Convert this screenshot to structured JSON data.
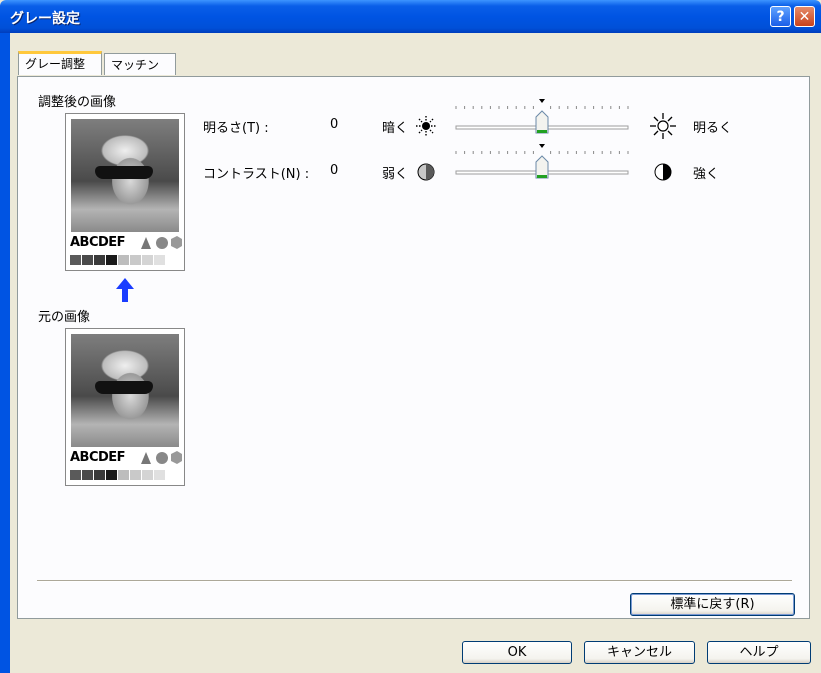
{
  "window": {
    "title": "グレー設定",
    "help_label": "?",
    "close_label": "✕"
  },
  "tabs": [
    {
      "label": "グレー調整",
      "active": true
    },
    {
      "label": "マッチング",
      "active": false
    }
  ],
  "preview": {
    "adjusted_label": "調整後の画像",
    "original_label": "元の画像",
    "sample_text": "ABCDEF",
    "swatch_colors": [
      "#5a5a5a",
      "#4a4a4a",
      "#3a3a3a",
      "#1a1a1a",
      "#bdbdbd",
      "#c9c9c9",
      "#d4d4d4",
      "#e0e0e0"
    ]
  },
  "brightness": {
    "label": "明るさ(T) :",
    "value": "0",
    "low_label": "暗く",
    "high_label": "明るく",
    "position": 0.5
  },
  "contrast": {
    "label": "コントラスト(N) :",
    "value": "0",
    "low_label": "弱く",
    "high_label": "強く",
    "position": 0.5
  },
  "buttons": {
    "reset": "標準に戻す(R)",
    "ok": "OK",
    "cancel": "キャンセル",
    "help": "ヘルプ"
  }
}
